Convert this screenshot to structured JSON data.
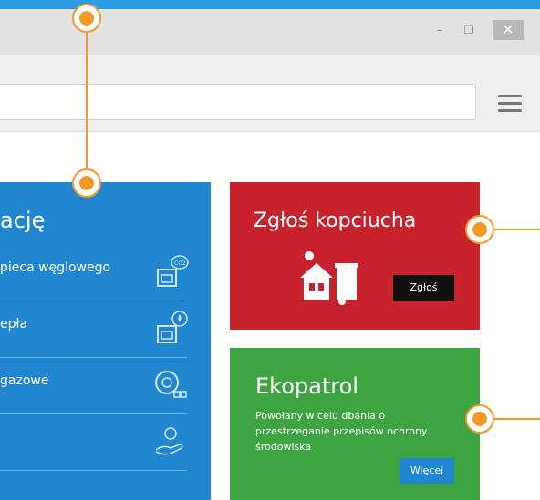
{
  "window": {
    "minimize_glyph": "–",
    "restore_glyph": "❐",
    "close_glyph": "✕"
  },
  "panel_blue": {
    "title": "ację",
    "rows": [
      {
        "label": "pieca węglowego",
        "icon": "co2-furnace-icon"
      },
      {
        "label": "epła",
        "icon": "heat-pump-icon"
      },
      {
        "label": "gazowe",
        "icon": "gas-boiler-icon"
      },
      {
        "label": "",
        "icon": "hand-coin-icon"
      }
    ]
  },
  "card_report": {
    "title": "Zgłoś kopciucha",
    "button": "Zgłoś",
    "icon": "smoke-house-bin-icon"
  },
  "card_ekopatrol": {
    "title": "Ekopatrol",
    "description": "Powołany w celu dbania o przestrzeganie przepisów ochrony środowiska",
    "button": "Więcej"
  },
  "colors": {
    "blue": "#1f86cf",
    "red": "#c8232c",
    "green": "#3ea341",
    "accent": "#f39a26"
  }
}
